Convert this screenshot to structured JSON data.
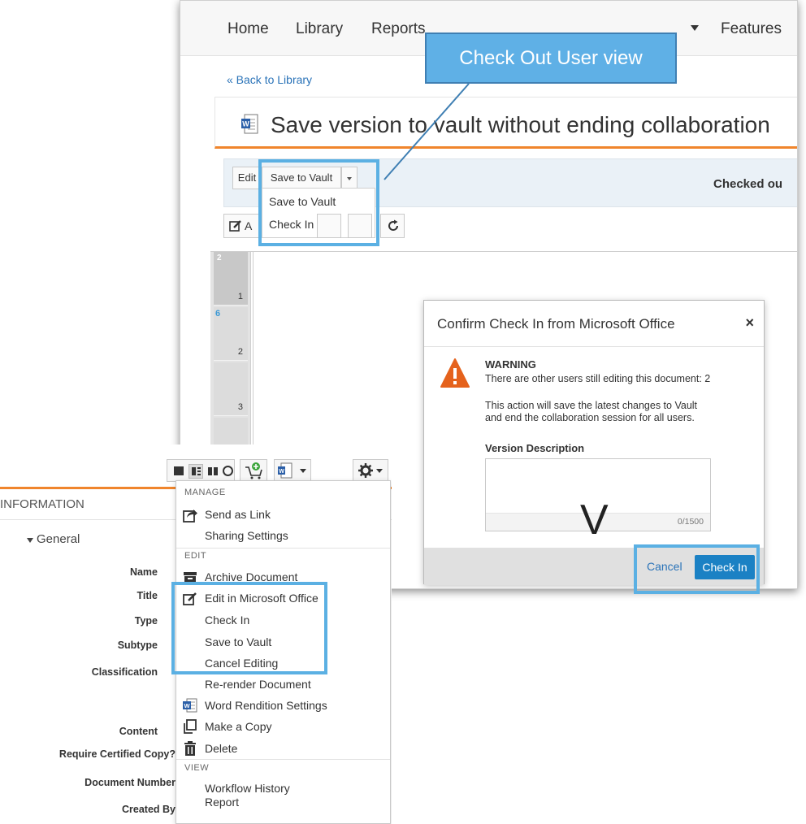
{
  "nav": {
    "items": [
      "Home",
      "Library",
      "Reports",
      "Features"
    ]
  },
  "back_link": "« Back to Library",
  "doc_title": "Save version to vault without ending collaboration",
  "toolbar": {
    "edit_label": "Edit",
    "save_to_vault_label": "Save to Vault",
    "checked_out_text": "Checked ou",
    "dropdown_items": [
      "Save to Vault",
      "Check In"
    ],
    "annotate_label": "A"
  },
  "thumbnails": [
    {
      "badge": "2",
      "number": "1"
    },
    {
      "badge": "6",
      "number": "2"
    },
    {
      "badge": "",
      "number": "3"
    }
  ],
  "page_text": "V",
  "callout": {
    "text": "Check Out User view"
  },
  "dialog": {
    "title": "Confirm Check In from Microsoft Office",
    "close": "×",
    "warning_title": "WARNING",
    "warning_line1": "There are other users still editing this document: 2",
    "warning_line2": "This action will save the latest changes to Vault",
    "warning_line3": "and end the collaboration session for all users.",
    "version_label": "Version Description",
    "char_count": "0/1500",
    "cancel_label": "Cancel",
    "checkin_label": "Check In"
  },
  "info_panel": {
    "header": "INFORMATION",
    "section": "General",
    "fields": [
      "Name",
      "Title",
      "Type",
      "Subtype",
      "Classification",
      "Content",
      "Require Certified Copy?",
      "Document Number",
      "Created By"
    ]
  },
  "context_menu": {
    "manage_heading": "MANAGE",
    "send_as_link": "Send as Link",
    "sharing_settings": "Sharing Settings",
    "edit_heading": "EDIT",
    "archive_document": "Archive Document",
    "edit_in_office": "Edit in Microsoft Office",
    "check_in": "Check In",
    "save_to_vault": "Save to Vault",
    "cancel_editing": "Cancel Editing",
    "rerender": "Re-render Document",
    "word_rendition": "Word Rendition Settings",
    "make_copy": "Make a Copy",
    "delete": "Delete",
    "view_heading": "VIEW",
    "workflow_history": "Workflow History",
    "report": "Report"
  },
  "colors": {
    "accent_orange": "#f0852c",
    "highlight_blue": "#5bb0e3",
    "callout_blue": "#5fb0e6",
    "primary_button": "#1b81c4",
    "link_blue": "#2a73b8",
    "warning_orange": "#e5621c"
  },
  "icons": [
    "word-doc-icon",
    "refresh-icon",
    "edit-icon",
    "warning-icon",
    "send-link-icon",
    "archive-icon",
    "word-icon",
    "copy-icon",
    "trash-icon",
    "gear-icon",
    "cart-icon"
  ]
}
